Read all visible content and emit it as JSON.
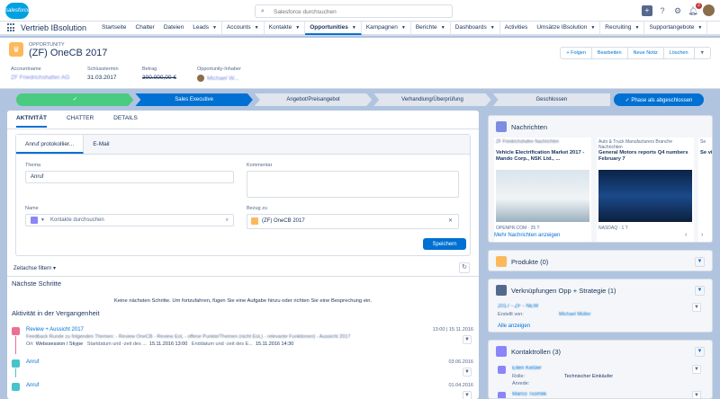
{
  "topbar": {
    "logo": "salesforce",
    "search_placeholder": "Salesforce durchsuchen",
    "help": "?",
    "notif_count": "2"
  },
  "nav": {
    "app_name": "Vertrieb IBsolution",
    "items": [
      {
        "label": "Startseite",
        "dd": false
      },
      {
        "label": "Chatter",
        "dd": false
      },
      {
        "label": "Dateien",
        "dd": false
      },
      {
        "label": "Leads",
        "dd": true
      },
      {
        "label": "Accounts",
        "dd": true
      },
      {
        "label": "Kontakte",
        "dd": true
      },
      {
        "label": "Opportunities",
        "dd": true,
        "active": true
      },
      {
        "label": "Kampagnen",
        "dd": true
      },
      {
        "label": "Berichte",
        "dd": true
      },
      {
        "label": "Dashboards",
        "dd": true
      },
      {
        "label": "Activities",
        "dd": false
      },
      {
        "label": "Umsätze IBsolution",
        "dd": true
      },
      {
        "label": "Recruiting",
        "dd": true
      },
      {
        "label": "Supportangebote",
        "dd": true
      }
    ]
  },
  "header": {
    "type": "OPPORTUNITY",
    "title": "(ZF) OneCB 2017",
    "buttons": [
      "+ Folgen",
      "Bearbeiten",
      "Neue Notiz",
      "Löschen"
    ],
    "fields": [
      {
        "label": "Accountname",
        "value": "ZF Friedrichshafen AG",
        "blur": true
      },
      {
        "label": "Schlusstermin",
        "value": "31.03.2017"
      },
      {
        "label": "Betrag",
        "value": "300.000,00 €",
        "strike": true
      },
      {
        "label": "Opportunity-Inhaber",
        "value": "Michael W...",
        "blur": true
      }
    ]
  },
  "path": {
    "steps": [
      "✓",
      "Sales Executive",
      "Angebot/Preisangebot",
      "Verhandlung/Überprüfung",
      "Geschlossen"
    ],
    "button": "✓ Phase als abgeschlossen"
  },
  "tabs": [
    "AKTIVITÄT",
    "CHATTER",
    "DETAILS"
  ],
  "composer": {
    "tabs": [
      "Anruf protokollier...",
      "E-Mail"
    ],
    "thema_label": "Thema",
    "thema_value": "Anruf",
    "kommentar_label": "Kommentar",
    "name_label": "Name",
    "name_placeholder": "Kontakte durchsuchen",
    "bezug_label": "Bezug zu",
    "bezug_value": "(ZF) OneCB 2017",
    "save": "Speichern"
  },
  "activity": {
    "filter": "Zeitachse filtern",
    "next_title": "Nächste Schritte",
    "next_empty": "Keine nächsten Schritte. Um fortzufahren, fügen Sie eine Aufgabe hinzu oder richten Sie eine Besprechung ein.",
    "past_title": "Aktivität in der Vergangenheit",
    "items": [
      {
        "title": "Review + Aussicht 2017",
        "date": "13:00 | 15.11.2016",
        "desc": "Feedback Runde zu folgenden Themen: - Review OneCB - Review EoL - offene Punkte/Themen (nicht EoL) - relevante Funktionen) - Aussicht 2017",
        "ort_label": "Ort",
        "ort": "Webssession / Skype",
        "start_label": "Startdatum und -zeit des ...",
        "start": "15.11.2016 13:00",
        "end_label": "Enddatum und -zeit des E...",
        "end": "15.11.2016 14:30"
      },
      {
        "title": "Anruf",
        "date": "03.06.2016"
      },
      {
        "title": "Anruf",
        "date": "01.04.2016"
      }
    ]
  },
  "nachrichten": {
    "title": "Nachrichten",
    "items": [
      {
        "source": "ZF Friedrichshafen Nachrichten",
        "title": "Vehicle Electrification Market 2017 - Mando Corp., NSK Ltd., ...",
        "footer": "OPENPR.COM · 25 T"
      },
      {
        "source": "Auto & Truck Manufacturers Branche Nachrichten",
        "title": "General Motors reports Q4 numbers February 7",
        "footer": "NASDAQ · 1 T"
      },
      {
        "source": "Se",
        "title": "Se vir",
        "footer": ""
      }
    ],
    "more": "Mehr Nachrichten anzeigen"
  },
  "produkte": {
    "title": "Produkte (0)"
  },
  "verknuepfungen": {
    "title": "Verknüpfungen Opp + Strategie (1)",
    "item_name": "2017 - ZF - NEW",
    "created_label": "Erstellt von:",
    "created_by": "Michael Müller",
    "show_all": "Alle anzeigen"
  },
  "kontaktrollen": {
    "title": "Kontaktrollen (3)",
    "name": "Ellen Keßler",
    "rolle_label": "Rolle:",
    "rolle": "Technischer Einkäufer",
    "anrede_label": "Anrede:",
    "name2": "Marco Tsomlik"
  },
  "colors": {
    "brand": "#0070d2",
    "path_done": "#4bca81",
    "opp_icon": "#fcb95b"
  }
}
